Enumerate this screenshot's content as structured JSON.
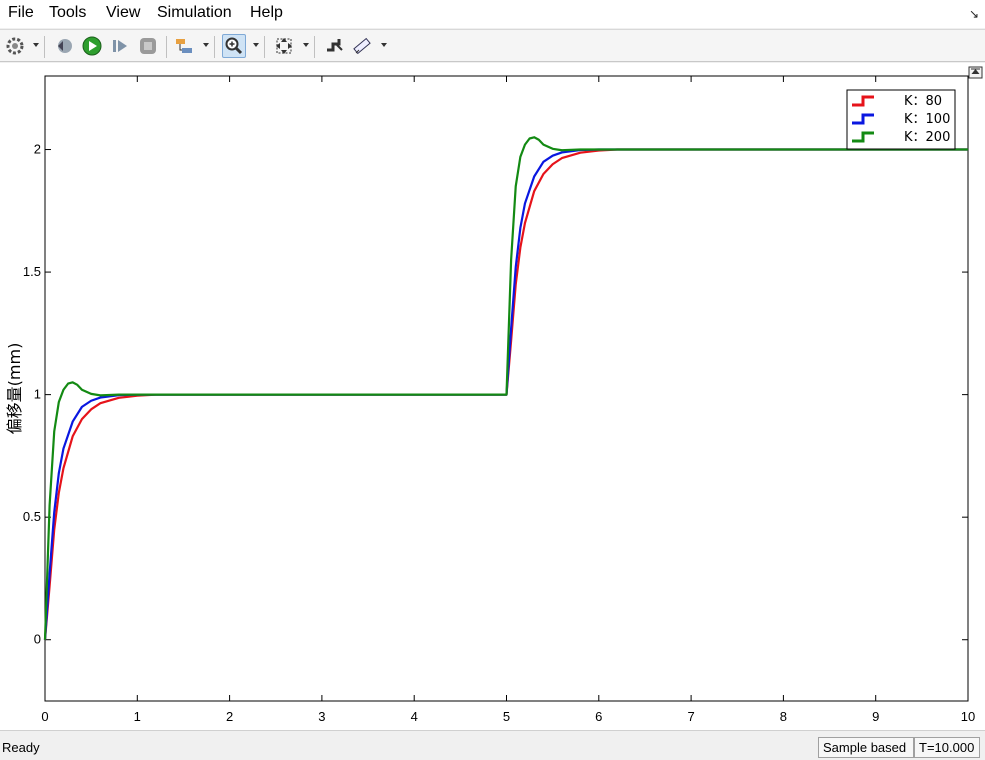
{
  "menu": {
    "items": [
      "File",
      "Tools",
      "View",
      "Simulation",
      "Help"
    ],
    "undock_glyph": "↘"
  },
  "toolbar": {
    "icons": [
      "gear-icon",
      "step-back-icon",
      "run-icon",
      "step-forward-icon",
      "stop-icon",
      "signal-selector-icon",
      "zoom-icon",
      "fit-to-view-icon",
      "highlight-icon",
      "measure-icon"
    ],
    "run_color": "#2e9e2e",
    "active_accent": "#cfe3f5"
  },
  "chart_data": {
    "type": "line",
    "ylabel": "偏移量(mm)",
    "xlim": [
      0,
      10
    ],
    "ylim": [
      -0.25,
      2.3
    ],
    "xticks": [
      0,
      1,
      2,
      3,
      4,
      5,
      6,
      7,
      8,
      9,
      10
    ],
    "yticks": [
      0,
      0.5,
      1,
      1.5,
      2
    ],
    "ytick_labels": [
      "0",
      "0.5",
      "1",
      "1.5",
      "2"
    ],
    "legend_position": "top-right",
    "series": [
      {
        "name": "K：80",
        "color": "#e6131a",
        "x": [
          0,
          0.05,
          0.1,
          0.15,
          0.2,
          0.3,
          0.4,
          0.5,
          0.6,
          0.8,
          1.0,
          1.2,
          5.0,
          5.05,
          5.1,
          5.15,
          5.2,
          5.3,
          5.4,
          5.5,
          5.6,
          5.8,
          6.0,
          6.2,
          10
        ],
        "y": [
          0,
          0.22,
          0.45,
          0.6,
          0.7,
          0.83,
          0.9,
          0.94,
          0.965,
          0.987,
          0.996,
          1.0,
          1.0,
          1.22,
          1.45,
          1.6,
          1.7,
          1.83,
          1.9,
          1.94,
          1.965,
          1.987,
          1.996,
          2.0,
          2.0
        ]
      },
      {
        "name": "K：100",
        "color": "#0a17e0",
        "x": [
          0,
          0.05,
          0.1,
          0.15,
          0.2,
          0.3,
          0.4,
          0.5,
          0.6,
          0.8,
          1.0,
          5.0,
          5.05,
          5.1,
          5.15,
          5.2,
          5.3,
          5.4,
          5.5,
          5.6,
          5.8,
          6.0,
          10
        ],
        "y": [
          0,
          0.27,
          0.52,
          0.68,
          0.78,
          0.89,
          0.95,
          0.975,
          0.988,
          0.998,
          1.0,
          1.0,
          1.27,
          1.52,
          1.68,
          1.78,
          1.89,
          1.95,
          1.975,
          1.988,
          1.998,
          2.0,
          2.0
        ]
      },
      {
        "name": "K：200",
        "color": "#138a13",
        "x": [
          0,
          0.05,
          0.1,
          0.15,
          0.2,
          0.25,
          0.3,
          0.35,
          0.4,
          0.5,
          0.6,
          0.8,
          5.0,
          5.05,
          5.1,
          5.15,
          5.2,
          5.25,
          5.3,
          5.35,
          5.4,
          5.5,
          5.6,
          5.8,
          10
        ],
        "y": [
          0,
          0.55,
          0.85,
          0.97,
          1.02,
          1.045,
          1.05,
          1.04,
          1.02,
          1.003,
          0.997,
          1.0,
          1.0,
          1.55,
          1.85,
          1.97,
          2.02,
          2.045,
          2.05,
          2.04,
          2.02,
          2.003,
          1.997,
          2.0,
          2.0
        ]
      }
    ]
  },
  "status": {
    "text": "Ready",
    "mode": "Sample based",
    "time": "T=10.000"
  }
}
